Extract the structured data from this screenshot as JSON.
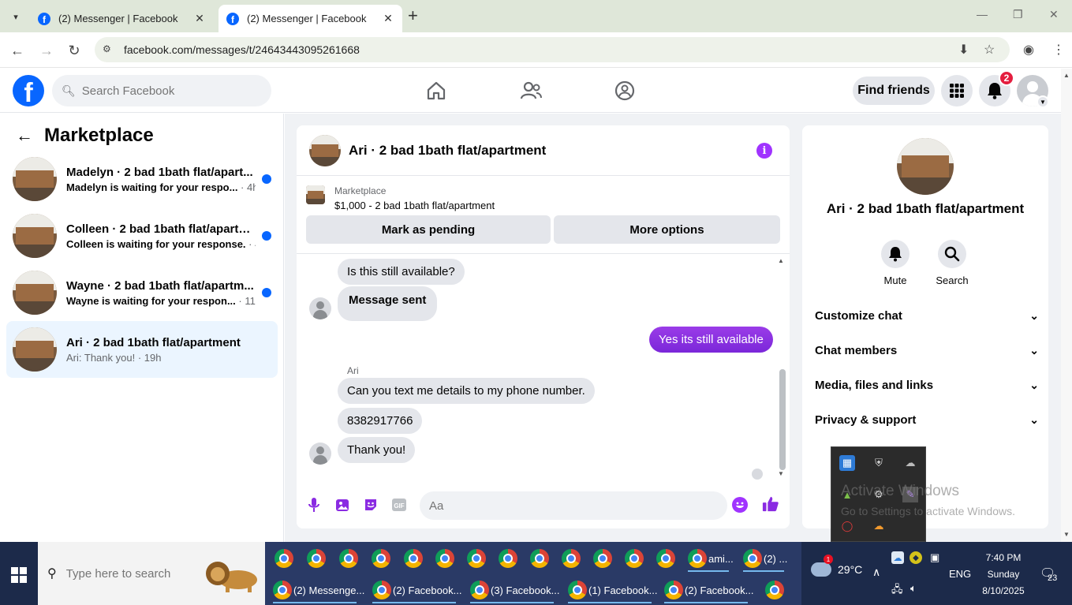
{
  "browser": {
    "tabs": [
      {
        "title": "(2) Messenger | Facebook",
        "active": false
      },
      {
        "title": "(2) Messenger | Facebook",
        "active": true
      }
    ],
    "url": "facebook.com/messages/t/24643443095261668"
  },
  "fb_nav": {
    "search_placeholder": "Search Facebook",
    "find_friends": "Find friends",
    "notification_count": "2"
  },
  "left_panel": {
    "title": "Marketplace",
    "conversations": [
      {
        "name": "Madelyn · 2 bad 1bath flat/apart...",
        "preview": "Madelyn is waiting for your respo...",
        "time": " · 4h",
        "unread": true
      },
      {
        "name": "Colleen · 2 bad 1bath flat/apartm...",
        "preview": "Colleen is waiting for your response.",
        "time": " · 4h",
        "unread": true
      },
      {
        "name": "Wayne · 2 bad 1bath flat/apartm...",
        "preview": "Wayne is waiting for your respon...",
        "time": " · 11h",
        "unread": true
      },
      {
        "name": "Ari · 2 bad 1bath flat/apartment",
        "preview": "Ari: Thank you!",
        "time": " · 19h",
        "unread": false
      }
    ]
  },
  "chat": {
    "title": "Ari · 2 bad 1bath flat/apartment",
    "marketplace_label": "Marketplace",
    "listing": "$1,000 - 2 bad 1bath flat/apartment",
    "mark_pending": "Mark as pending",
    "more_options": "More options",
    "messages": [
      {
        "text": "Is this still available?",
        "direction": "in"
      },
      {
        "text": "Message sent",
        "direction": "in"
      },
      {
        "text": "Yes its still available",
        "direction": "out"
      },
      {
        "text": "Can you text me details to my phone number.",
        "direction": "in"
      },
      {
        "text": "8382917766",
        "direction": "in"
      },
      {
        "text": "Thank you!",
        "direction": "in"
      }
    ],
    "sender_name": "Ari",
    "composer_placeholder": "Aa"
  },
  "info_panel": {
    "name": "Ari · 2 bad 1bath flat/apartment",
    "mute": "Mute",
    "search": "Search",
    "sections": [
      "Customize chat",
      "Chat members",
      "Media, files and links",
      "Privacy & support"
    ]
  },
  "watermark": {
    "line1": "Activate Windows",
    "line2": "Go to Settings to activate Windows."
  },
  "taskbar": {
    "search_placeholder": "Type here to search",
    "top_row_labels": [
      "ami...",
      "(2) ..."
    ],
    "bottom_row_labels": [
      "(2) Messenge...",
      "(2) Facebook...",
      "(3) Facebook...",
      "(1) Facebook...",
      "(2) Facebook..."
    ],
    "temperature": "29°C",
    "weather_badge": "1",
    "language": "ENG",
    "time": "7:40 PM",
    "day": "Sunday",
    "date": "8/10/2025",
    "notification_count": "23"
  },
  "colors": {
    "fb_blue": "#0866ff",
    "messenger_purple": "#8a2be2",
    "unread_dot": "#0866ff",
    "badge_red": "#e41e3f"
  }
}
